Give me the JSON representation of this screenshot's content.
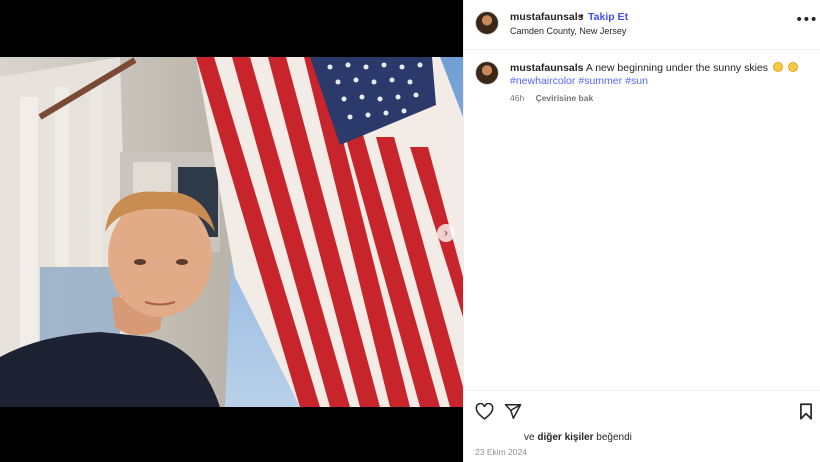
{
  "post": {
    "username": "mustafaunsals",
    "separator": "•",
    "follow_label": "Takip Et",
    "location": "Camden County, New Jersey",
    "more_icon": "more-horizontal-icon",
    "more_glyph": "•••"
  },
  "caption": {
    "username": "mustafaunsals",
    "text": "A new beginning under the sunny skies",
    "emojis": [
      "sun-emoji",
      "crescent-moon-emoji"
    ],
    "hashtags": [
      "#newhaircolor",
      "#summer",
      "#sun"
    ],
    "time": "46h",
    "translate_label": "Çevirisine bak"
  },
  "media": {
    "next_glyph": "›",
    "next_icon": "chevron-right-icon"
  },
  "actions": {
    "like_icon": "heart-icon",
    "share_icon": "send-icon",
    "save_icon": "bookmark-icon"
  },
  "likes": {
    "prefix": "ve",
    "others": "diğer kişiler",
    "suffix": "beğendi"
  },
  "date": "23 Ekim 2024",
  "colors": {
    "link": "#4150f7",
    "hashtag": "#5468ff",
    "muted": "#737373",
    "border": "#efefef"
  }
}
